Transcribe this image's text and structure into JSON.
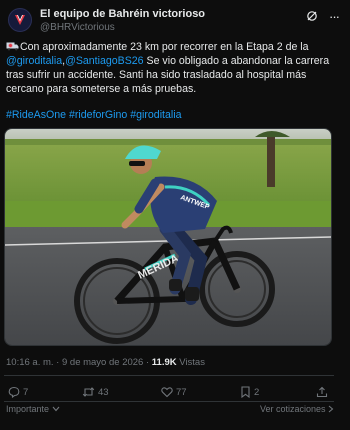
{
  "author": {
    "name": "El equipo de Bahréin victorioso",
    "handle": "@BHRVictorious"
  },
  "tweet": {
    "line1": "Con aproximadamente 23 km por recorrer en la Etapa 2 de la",
    "mention1": "@giroditalia",
    "mention_sep": ",",
    "mention2": "@SantiagoBS26",
    "line2_rest": "Se vio obligado a abandonar la carrera tras sufrir un accidente. Santi ha sido trasladado al hospital más cercano para someterse a más pruebas.",
    "hashtags": "#RideAsOne #rideforGino #giroditalia"
  },
  "media": {
    "kit_text": "ANTWEP",
    "bike_brand": "MERIDA"
  },
  "meta": {
    "time": "10:16 a. m.",
    "separator": " · ",
    "date": "9 de mayo de 2026",
    "views_count": "11.9K",
    "views_label": "Vistas"
  },
  "actions": {
    "replies": "7",
    "reposts": "43",
    "likes": "77",
    "bookmarks": "2"
  },
  "footer": {
    "left_label": "Importante",
    "right_label": "Ver cotizaciones"
  },
  "colors": {
    "background": "#0d0d0d",
    "link": "#1d9bf0",
    "muted": "#71767b",
    "text": "#e7e9ea"
  }
}
